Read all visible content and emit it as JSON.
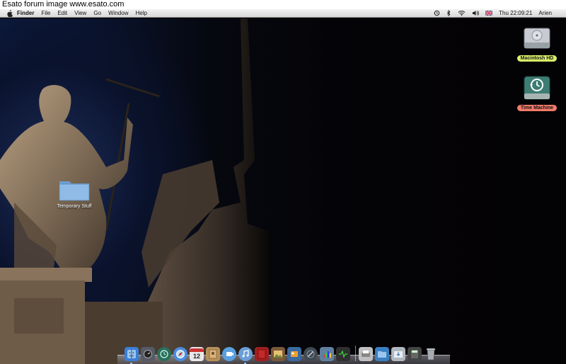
{
  "watermark": "Esato forum image www.esato.com",
  "menubar": {
    "apple_icon": "apple-logo-icon",
    "items": [
      "Finder",
      "File",
      "Edit",
      "View",
      "Go",
      "Window",
      "Help"
    ],
    "status": {
      "time_machine_icon": "time-machine-status-icon",
      "bluetooth_icon": "bluetooth-icon",
      "wifi_icon": "wifi-icon",
      "volume_icon": "volume-icon",
      "flag_icon": "uk-flag-input-icon",
      "clock": "Thu 22:09:21",
      "user": "Arien"
    }
  },
  "desktop": {
    "icons": [
      {
        "label": "Macintosh HD",
        "icon": "hard-drive-icon"
      },
      {
        "label": "Time Machine",
        "icon": "time-machine-drive-icon"
      },
      {
        "label": "Temporary Stuff",
        "icon": "folder-icon"
      }
    ]
  },
  "dock": {
    "calendar_day": "12",
    "items": [
      {
        "name": "finder",
        "color": "#3b7fd6"
      },
      {
        "name": "dashboard",
        "color": "#555a66"
      },
      {
        "name": "time-machine",
        "color": "#2b6e5c"
      },
      {
        "name": "safari",
        "color": "#4a8de0"
      },
      {
        "name": "ical",
        "color": "#e8e8e8"
      },
      {
        "name": "address-book",
        "color": "#b8915a"
      },
      {
        "name": "ichat",
        "color": "#5aa0e0"
      },
      {
        "name": "itunes",
        "color": "#6a9ed8"
      },
      {
        "name": "book",
        "color": "#a02020"
      },
      {
        "name": "preview",
        "color": "#7a5a3a"
      },
      {
        "name": "iphoto",
        "color": "#3a6aa0"
      },
      {
        "name": "xcode",
        "color": "#404850"
      },
      {
        "name": "keynote",
        "color": "#6080a0"
      },
      {
        "name": "activity",
        "color": "#303030"
      },
      {
        "name": "printer",
        "color": "#c0c0c0"
      },
      {
        "name": "documents-stack",
        "color": "#3a80c0"
      },
      {
        "name": "downloads-stack",
        "color": "#b0b8c0"
      },
      {
        "name": "calculator",
        "color": "#444"
      },
      {
        "name": "trash",
        "color": "#909090"
      }
    ]
  }
}
